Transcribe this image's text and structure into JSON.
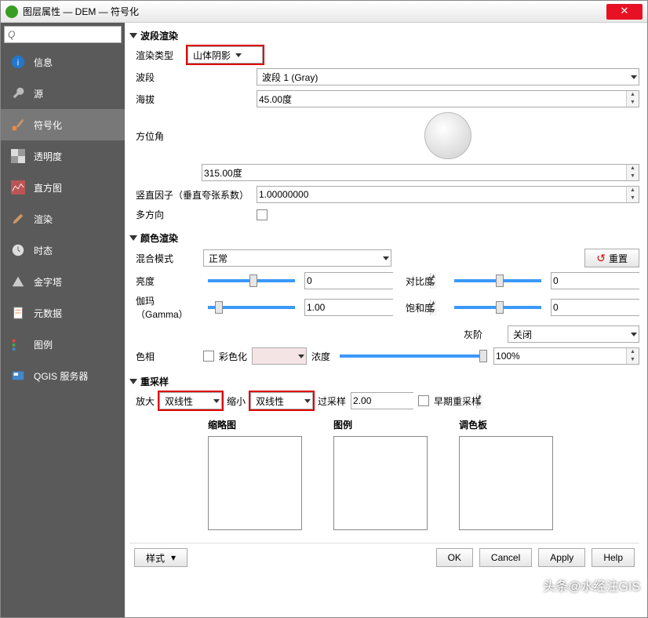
{
  "title": "图层属性 — DEM — 符号化",
  "search_placeholder": "Q",
  "sidebar": {
    "items": [
      {
        "label": "信息"
      },
      {
        "label": "源"
      },
      {
        "label": "符号化"
      },
      {
        "label": "透明度"
      },
      {
        "label": "直方图"
      },
      {
        "label": "渲染"
      },
      {
        "label": "时态"
      },
      {
        "label": "金字塔"
      },
      {
        "label": "元数据"
      },
      {
        "label": "图例"
      },
      {
        "label": "QGIS 服务器"
      }
    ]
  },
  "band": {
    "section_title": "波段渲染",
    "render_type_label": "渲染类型",
    "render_type_value": "山体阴影",
    "band_label": "波段",
    "band_value": "波段 1 (Gray)",
    "altitude_label": "海拔",
    "altitude_value": "45.00度",
    "azimuth_label": "方位角",
    "azimuth_value": "315.00度",
    "zfactor_label": "竖直因子（垂直夸张系数）",
    "zfactor_value": "1.00000000",
    "multidir_label": "多方向"
  },
  "color": {
    "section_title": "颜色渲染",
    "blend_label": "混合模式",
    "blend_value": "正常",
    "reset_label": "重置",
    "brightness_label": "亮度",
    "brightness_value": "0",
    "contrast_label": "对比度",
    "contrast_value": "0",
    "gamma_label": "伽玛（Gamma）",
    "gamma_value": "1.00",
    "saturation_label": "饱和度",
    "saturation_value": "0",
    "grayscale_label": "灰阶",
    "grayscale_value": "关闭",
    "hue_label": "色相",
    "colorize_label": "彩色化",
    "strength_label": "浓度",
    "strength_value": "100%"
  },
  "resample": {
    "section_title": "重采样",
    "zoom_in_label": "放大",
    "zoom_in_value": "双线性",
    "zoom_out_label": "缩小",
    "zoom_out_value": "双线性",
    "oversample_label": "过采样",
    "oversample_value": "2.00",
    "early_label": "早期重采样",
    "thumb_label": "缩略图",
    "legend_label": "图例",
    "palette_label": "调色板"
  },
  "footer": {
    "style_label": "样式",
    "ok": "OK",
    "cancel": "Cancel",
    "apply": "Apply",
    "help": "Help"
  },
  "watermark": "头条@水经注GIS"
}
